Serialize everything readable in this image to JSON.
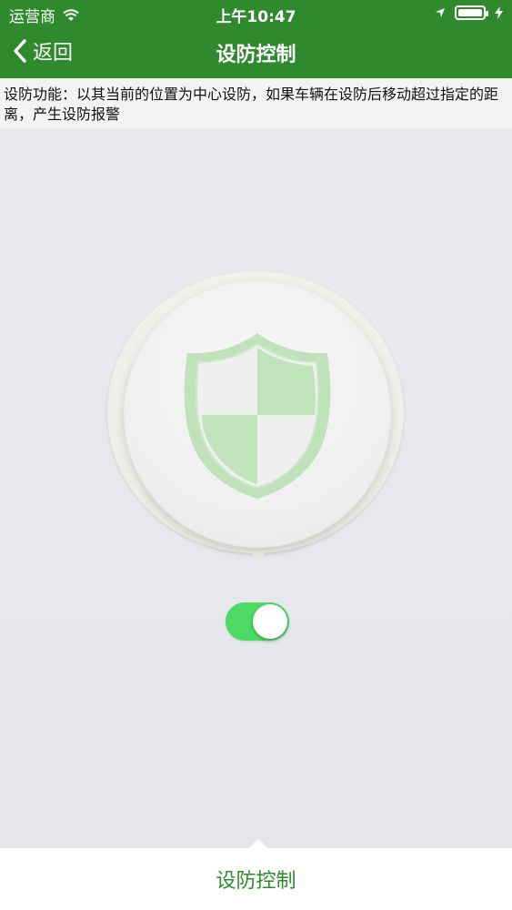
{
  "status_bar": {
    "carrier": "运营商",
    "time": "上午10:47",
    "wifi_icon": "wifi-icon",
    "location_icon": "location-arrow-icon",
    "battery_icon": "battery-icon",
    "charging_icon": "lightning-icon"
  },
  "nav": {
    "back_label": "返回",
    "title": "设防控制"
  },
  "notice": {
    "text": "设防功能：以其当前的位置为中心设防，如果车辆在设防后移动超过指定的距离，产生设防报警"
  },
  "fortify": {
    "shield_icon": "shield-icon",
    "toggle_on": true
  },
  "bottom_bar": {
    "label": "设防控制"
  },
  "colors": {
    "brand_green": "#2f8a2d",
    "toggle_green": "#4cd964",
    "shield_green": "#b9dfb6"
  }
}
